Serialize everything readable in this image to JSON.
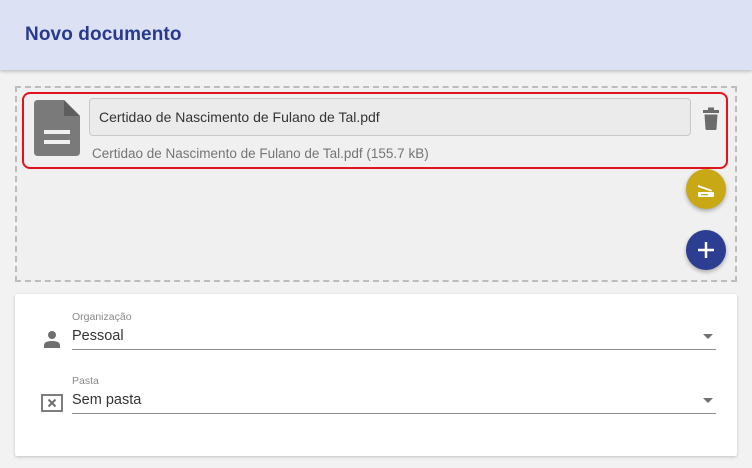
{
  "header": {
    "title": "Novo documento"
  },
  "file": {
    "name_value": "Certidao de Nascimento de Fulano de Tal.pdf",
    "meta": "Certidao de Nascimento de Fulano de Tal.pdf (155.7 kB)",
    "icon": "document-icon",
    "delete_icon": "trash-icon",
    "highlight_color": "#e0141e"
  },
  "actions": {
    "scan_icon": "scanner-icon",
    "scan_color": "#c9a816",
    "add_icon": "plus-icon",
    "add_color": "#2c3e92"
  },
  "form": {
    "organization": {
      "label": "Organização",
      "value": "Pessoal",
      "icon": "person-icon"
    },
    "folder": {
      "label": "Pasta",
      "value": "Sem pasta",
      "icon": "no-folder-icon"
    }
  },
  "colors": {
    "header_bg": "#dde1f4",
    "header_text": "#283a8c"
  }
}
